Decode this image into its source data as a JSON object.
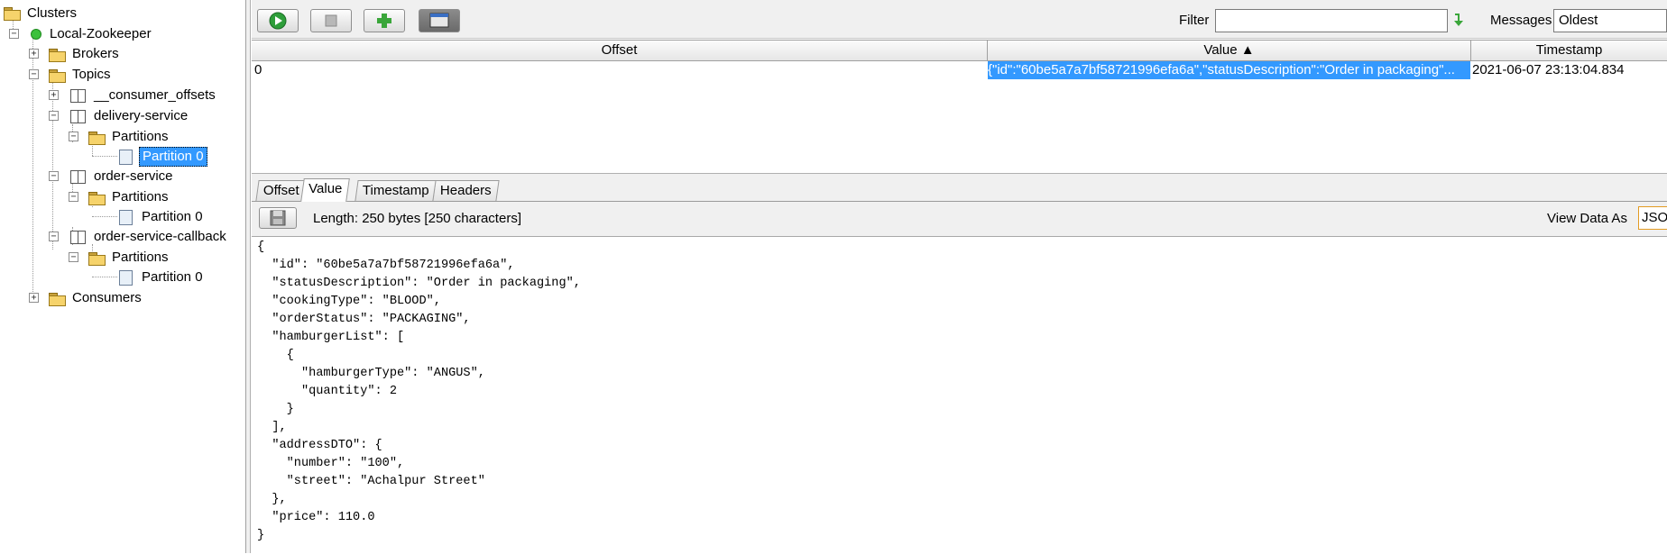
{
  "tree": {
    "clusters": "Clusters",
    "cluster": "Local-Zookeeper",
    "brokers": "Brokers",
    "topics": "Topics",
    "consumer_offsets": "__consumer_offsets",
    "delivery_service": "delivery-service",
    "partitions": "Partitions",
    "partition0": "Partition 0",
    "order_service": "order-service",
    "order_service_callback": "order-service-callback",
    "consumers": "Consumers"
  },
  "toolbar": {
    "filter_label": "Filter",
    "filter_value": "",
    "messages_label": "Messages",
    "messages_value": "Oldest"
  },
  "grid": {
    "columns": [
      "Offset",
      "Value ▲",
      "Timestamp"
    ],
    "rows": [
      {
        "offset": "0",
        "value": "{\"id\":\"60be5a7a7bf58721996efa6a\",\"statusDescription\":\"Order in packaging\"...",
        "timestamp": "2021-06-07 23:13:04.834"
      }
    ]
  },
  "detail": {
    "tabs": [
      "Offset",
      "Value",
      "Timestamp",
      "Headers"
    ],
    "active_tab": "Value",
    "length_text": "Length: 250 bytes [250 characters]",
    "view_as_label": "View Data As",
    "view_as_value": "JSON",
    "json_text": "{\n  \"id\": \"60be5a7a7bf58721996efa6a\",\n  \"statusDescription\": \"Order in packaging\",\n  \"cookingType\": \"BLOOD\",\n  \"orderStatus\": \"PACKAGING\",\n  \"hamburgerList\": [\n    {\n      \"hamburgerType\": \"ANGUS\",\n      \"quantity\": 2\n    }\n  ],\n  \"addressDTO\": {\n    \"number\": \"100\",\n    \"street\": \"Achalpur Street\"\n  },\n  \"price\": 110.0\n}"
  }
}
